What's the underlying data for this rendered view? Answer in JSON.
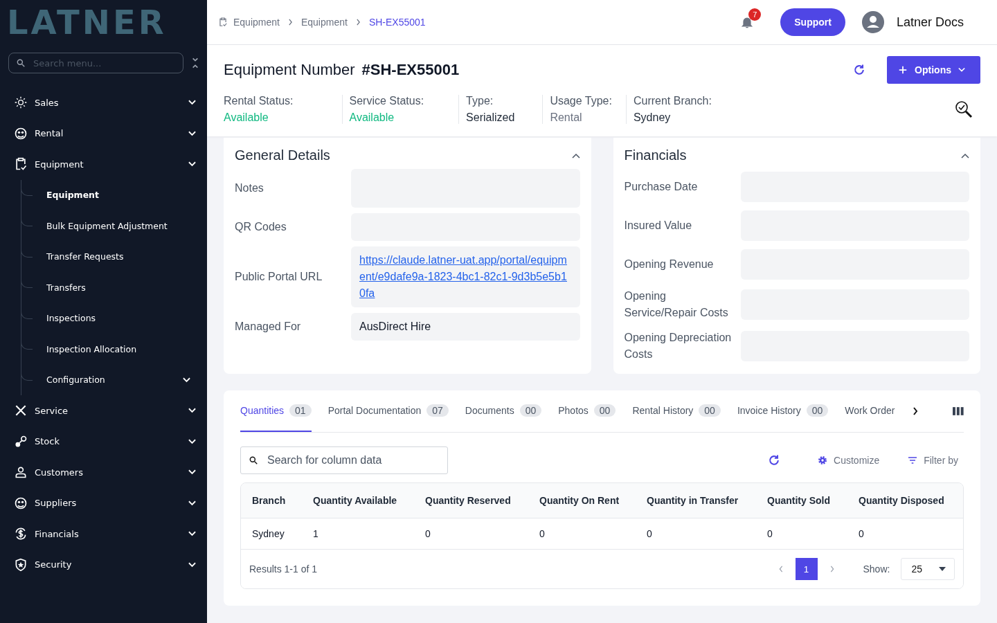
{
  "sidebar": {
    "logo": "LATNER",
    "search": {
      "placeholder": "Search menu..."
    },
    "items": [
      {
        "label": "Sales"
      },
      {
        "label": "Rental"
      },
      {
        "label": "Equipment",
        "children": [
          {
            "label": "Equipment",
            "selected": true,
            "kind": "link"
          },
          {
            "label": "Bulk Equipment Adjustment",
            "selected": false,
            "kind": "link"
          },
          {
            "label": "Transfer Requests",
            "selected": false,
            "kind": "link"
          },
          {
            "label": "Transfers",
            "selected": false,
            "kind": "link"
          },
          {
            "label": "Inspections",
            "selected": false,
            "kind": "link"
          },
          {
            "label": "Inspection Allocation",
            "selected": false,
            "kind": "link"
          },
          {
            "label": "Configuration",
            "selected": false,
            "kind": "group"
          }
        ]
      },
      {
        "label": "Service"
      },
      {
        "label": "Stock"
      },
      {
        "label": "Customers"
      },
      {
        "label": "Suppliers"
      },
      {
        "label": "Financials"
      },
      {
        "label": "Security"
      }
    ]
  },
  "topbar": {
    "breadcrumb": [
      "Equipment",
      "Equipment",
      "SH-EX55001"
    ],
    "notification_count": "7",
    "support": "Support",
    "user": "Latner Docs"
  },
  "header": {
    "title": "Equipment Number",
    "number": "#SH-EX55001",
    "options": "Options",
    "statuses": [
      {
        "label": "Rental Status:",
        "value": "Available",
        "kind": "success"
      },
      {
        "label": "Service Status:",
        "value": "Available",
        "kind": "success"
      },
      {
        "label": "Type:",
        "value": "Serialized",
        "kind": "default"
      },
      {
        "label": "Usage Type:",
        "value": "Rental",
        "kind": "muted"
      },
      {
        "label": "Current Branch:",
        "value": "Sydney",
        "kind": "default"
      }
    ]
  },
  "general_details": {
    "title": "General Details",
    "fields": [
      {
        "label": "Notes",
        "kind": "tall"
      },
      {
        "label": "QR Codes",
        "kind": "text"
      },
      {
        "label": "Public Portal URL",
        "value": "https://claude.latner-uat.app/portal/equipment/e9dafe9a-1823-4bc1-82c1-9d3b5e5b10fa",
        "kind": "link"
      },
      {
        "label": "Managed For",
        "value": "AusDirect Hire",
        "kind": "text"
      }
    ]
  },
  "financials": {
    "title": "Financials",
    "fields": [
      {
        "label": "Purchase Date"
      },
      {
        "label": "Insured Value"
      },
      {
        "label": "Opening Revenue"
      },
      {
        "label": "Opening Service/Repair Costs"
      },
      {
        "label": "Opening Depreciation Costs"
      }
    ]
  },
  "tabs": [
    {
      "label": "Quantities",
      "count": "01",
      "selected": true
    },
    {
      "label": "Portal Documentation",
      "count": "07",
      "selected": false
    },
    {
      "label": "Documents",
      "count": "00",
      "selected": false
    },
    {
      "label": "Photos",
      "count": "00",
      "selected": false
    },
    {
      "label": "Rental History",
      "count": "00",
      "selected": false
    },
    {
      "label": "Invoice History",
      "count": "00",
      "selected": false
    },
    {
      "label": "Work Order",
      "selected": false
    }
  ],
  "table": {
    "search": {
      "placeholder": "Search for column data"
    },
    "customize": "Customize",
    "filter": "Filter by",
    "columns": [
      "Branch",
      "Quantity Available",
      "Quantity Reserved",
      "Quantity On Rent",
      "Quantity in Transfer",
      "Quantity Sold",
      "Quantity Disposed"
    ],
    "rows": [
      [
        "Sydney",
        "1",
        "0",
        "0",
        "0",
        "0",
        "0"
      ]
    ],
    "results": "Results 1-1 of 1",
    "pages": [
      {
        "label": "1",
        "selected": true
      }
    ],
    "show_label": "Show:",
    "page_size": "25"
  }
}
